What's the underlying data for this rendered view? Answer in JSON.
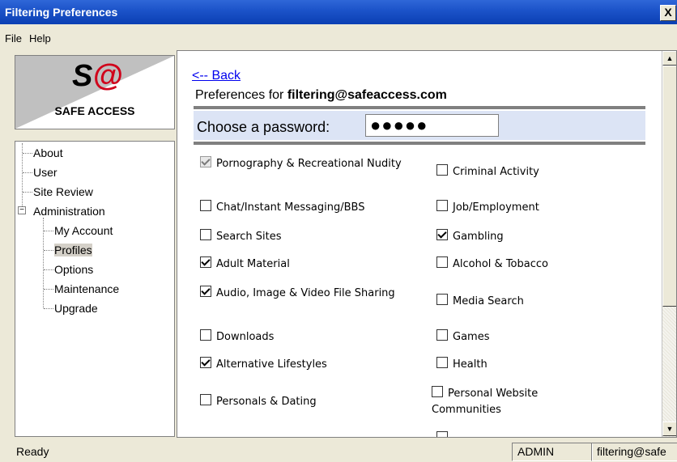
{
  "window": {
    "title": "Filtering Preferences",
    "close_symbol": "X"
  },
  "menu": {
    "file": "File",
    "help": "Help"
  },
  "logo": {
    "mark_s": "S",
    "mark_at": "@",
    "text": "SAFE ACCESS"
  },
  "tree": {
    "about": "About",
    "user": "User",
    "site_review": "Site Review",
    "administration": "Administration",
    "admin_expander": "−",
    "my_account": "My Account",
    "profiles": "Profiles",
    "options": "Options",
    "maintenance": "Maintenance",
    "upgrade": "Upgrade"
  },
  "content": {
    "back_link": "<-- Back",
    "heading_prefix": "Preferences for ",
    "heading_email": "filtering@safeaccess.com",
    "password_label": "Choose a password:",
    "password_value": "●●●●●"
  },
  "categories": {
    "pornography": {
      "label": "Pornography & Recreational Nudity",
      "checked": true,
      "disabled": true
    },
    "criminal": {
      "label": "Criminal Activity",
      "checked": false
    },
    "chat": {
      "label": "Chat/Instant Messaging/BBS",
      "checked": false
    },
    "job": {
      "label": "Job/Employment",
      "checked": false
    },
    "search_sites": {
      "label": "Search Sites",
      "checked": false
    },
    "gambling": {
      "label": "Gambling",
      "checked": true
    },
    "adult": {
      "label": "Adult Material",
      "checked": true
    },
    "alcohol": {
      "label": "Alcohol & Tobacco",
      "checked": false
    },
    "audio_image": {
      "label": "Audio, Image & Video File Sharing",
      "checked": true
    },
    "media_search": {
      "label": "Media Search",
      "checked": false
    },
    "downloads": {
      "label": "Downloads",
      "checked": false
    },
    "games": {
      "label": "Games",
      "checked": false
    },
    "alt_lifestyles": {
      "label": "Alternative Lifestyles",
      "checked": true
    },
    "health": {
      "label": "Health",
      "checked": false
    },
    "personals": {
      "label": "Personals & Dating",
      "checked": false
    },
    "personal_website": {
      "label": "Personal Website Communities",
      "checked": false
    }
  },
  "scrollbar": {
    "up": "▲",
    "down": "▼"
  },
  "status": {
    "ready": "Ready",
    "user": "ADMIN",
    "email": "filtering@safe"
  }
}
